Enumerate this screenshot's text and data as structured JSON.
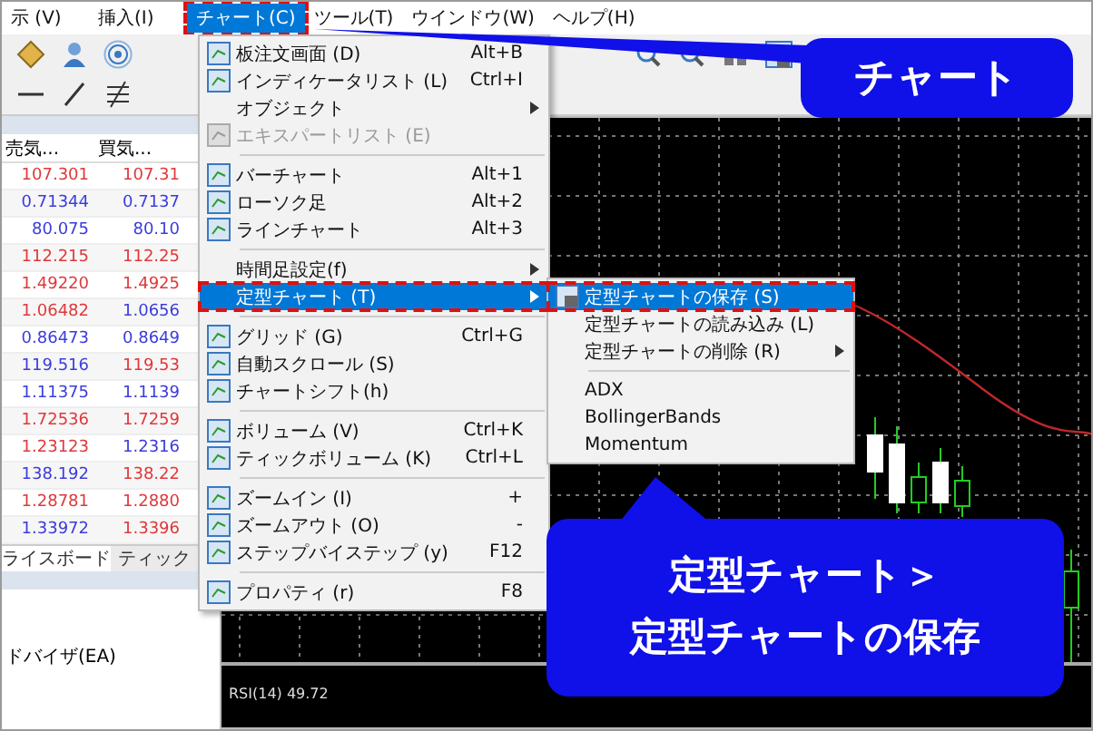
{
  "menubar": [
    {
      "label": "示 (V)",
      "selected": false
    },
    {
      "label": "挿入(I)",
      "selected": false
    },
    {
      "label": "チャート(C)",
      "selected": true
    },
    {
      "label": "ツール(T)",
      "selected": false
    },
    {
      "label": "ウインドウ(W)",
      "selected": false
    },
    {
      "label": "ヘルプ(H)",
      "selected": false
    }
  ],
  "market_watch": {
    "columns": [
      "売気...",
      "買気..."
    ],
    "rows": [
      {
        "bid": {
          "text": "107.301",
          "color": "#e0383a"
        },
        "ask": {
          "text": "107.31",
          "color": "#e0383a"
        }
      },
      {
        "bid": {
          "text": "0.71344",
          "color": "#3c3cdc"
        },
        "ask": {
          "text": "0.7137",
          "color": "#3c3cdc"
        }
      },
      {
        "bid": {
          "text": "80.075",
          "color": "#3c3cdc"
        },
        "ask": {
          "text": "80.10",
          "color": "#3c3cdc"
        }
      },
      {
        "bid": {
          "text": "112.215",
          "color": "#e0383a"
        },
        "ask": {
          "text": "112.25",
          "color": "#e0383a"
        }
      },
      {
        "bid": {
          "text": "1.49220",
          "color": "#e0383a"
        },
        "ask": {
          "text": "1.4925",
          "color": "#e0383a"
        }
      },
      {
        "bid": {
          "text": "1.06482",
          "color": "#e0383a"
        },
        "ask": {
          "text": "1.0656",
          "color": "#3c3cdc"
        }
      },
      {
        "bid": {
          "text": "0.86473",
          "color": "#3c3cdc"
        },
        "ask": {
          "text": "0.8649",
          "color": "#3c3cdc"
        }
      },
      {
        "bid": {
          "text": "119.516",
          "color": "#3c3cdc"
        },
        "ask": {
          "text": "119.53",
          "color": "#e0383a"
        }
      },
      {
        "bid": {
          "text": "1.11375",
          "color": "#3c3cdc"
        },
        "ask": {
          "text": "1.1139",
          "color": "#3c3cdc"
        }
      },
      {
        "bid": {
          "text": "1.72536",
          "color": "#e0383a"
        },
        "ask": {
          "text": "1.7259",
          "color": "#e0383a"
        }
      },
      {
        "bid": {
          "text": "1.23123",
          "color": "#e0383a"
        },
        "ask": {
          "text": "1.2316",
          "color": "#3c3cdc"
        }
      },
      {
        "bid": {
          "text": "138.192",
          "color": "#3c3cdc"
        },
        "ask": {
          "text": "138.22",
          "color": "#e0383a"
        }
      },
      {
        "bid": {
          "text": "1.28781",
          "color": "#e0383a"
        },
        "ask": {
          "text": "1.2880",
          "color": "#e0383a"
        }
      },
      {
        "bid": {
          "text": "1.33972",
          "color": "#3c3cdc"
        },
        "ask": {
          "text": "1.3396",
          "color": "#e0383a"
        }
      }
    ],
    "tabs": [
      {
        "label": "ライスボード",
        "selected": true
      },
      {
        "label": "ティック",
        "selected": false
      }
    ]
  },
  "navigator": {
    "item": "ドバイザ(EA)"
  },
  "chart_menu": [
    {
      "kind": "item",
      "label": "板注文画面 (D)",
      "shortcut": "Alt+B",
      "icon": true,
      "disabled": false,
      "submenu": false,
      "selected": false
    },
    {
      "kind": "item",
      "label": "インディケータリスト (L)",
      "shortcut": "Ctrl+I",
      "icon": true,
      "disabled": false,
      "submenu": false,
      "selected": false
    },
    {
      "kind": "item",
      "label": "オブジェクト",
      "icon": false,
      "disabled": false,
      "submenu": true,
      "selected": false
    },
    {
      "kind": "item",
      "label": "エキスパートリスト (E)",
      "icon": true,
      "disabled": true,
      "submenu": false,
      "selected": false
    },
    {
      "kind": "separator"
    },
    {
      "kind": "item",
      "label": "バーチャート",
      "shortcut": "Alt+1",
      "icon": true,
      "disabled": false,
      "submenu": false,
      "selected": false
    },
    {
      "kind": "item",
      "label": "ローソク足",
      "shortcut": "Alt+2",
      "icon": true,
      "disabled": false,
      "submenu": false,
      "selected": false
    },
    {
      "kind": "item",
      "label": "ラインチャート",
      "shortcut": "Alt+3",
      "icon": true,
      "disabled": false,
      "submenu": false,
      "selected": false
    },
    {
      "kind": "separator"
    },
    {
      "kind": "item",
      "label": "時間足設定(f)",
      "icon": false,
      "disabled": false,
      "submenu": true,
      "selected": false
    },
    {
      "kind": "item",
      "label": "定型チャート (T)",
      "icon": false,
      "disabled": false,
      "submenu": true,
      "selected": true
    },
    {
      "kind": "separator"
    },
    {
      "kind": "item",
      "label": "グリッド (G)",
      "shortcut": "Ctrl+G",
      "icon": true,
      "disabled": false,
      "submenu": false,
      "selected": false
    },
    {
      "kind": "item",
      "label": "自動スクロール (S)",
      "icon": true,
      "disabled": false,
      "submenu": false,
      "selected": false
    },
    {
      "kind": "item",
      "label": "チャートシフト(h)",
      "icon": true,
      "disabled": false,
      "submenu": false,
      "selected": false
    },
    {
      "kind": "separator"
    },
    {
      "kind": "item",
      "label": "ボリューム (V)",
      "shortcut": "Ctrl+K",
      "icon": true,
      "disabled": false,
      "submenu": false,
      "selected": false
    },
    {
      "kind": "item",
      "label": "ティックボリューム (K)",
      "shortcut": "Ctrl+L",
      "icon": true,
      "disabled": false,
      "submenu": false,
      "selected": false
    },
    {
      "kind": "separator"
    },
    {
      "kind": "item",
      "label": "ズームイン (I)",
      "shortcut": "+",
      "icon": true,
      "disabled": false,
      "submenu": false,
      "selected": false
    },
    {
      "kind": "item",
      "label": "ズームアウト (O)",
      "shortcut": "-",
      "icon": true,
      "disabled": false,
      "submenu": false,
      "selected": false
    },
    {
      "kind": "item",
      "label": "ステップバイステップ (y)",
      "shortcut": "F12",
      "icon": true,
      "disabled": false,
      "submenu": false,
      "selected": false
    },
    {
      "kind": "separator"
    },
    {
      "kind": "item",
      "label": "プロパティ (r)",
      "shortcut": "F8",
      "icon": true,
      "disabled": false,
      "submenu": false,
      "selected": false
    }
  ],
  "template_submenu": [
    {
      "kind": "item",
      "label": "定型チャートの保存 (S)",
      "icon": true,
      "submenu": false,
      "selected": true
    },
    {
      "kind": "item",
      "label": "定型チャートの読み込み (L)",
      "icon": false,
      "submenu": false,
      "selected": false
    },
    {
      "kind": "item",
      "label": "定型チャートの削除 (R)",
      "icon": false,
      "submenu": true,
      "selected": false
    },
    {
      "kind": "separator"
    },
    {
      "kind": "item",
      "label": "ADX",
      "icon": false,
      "submenu": false,
      "selected": false
    },
    {
      "kind": "item",
      "label": "BollingerBands",
      "icon": false,
      "submenu": false,
      "selected": false
    },
    {
      "kind": "item",
      "label": "Momentum",
      "icon": false,
      "submenu": false,
      "selected": false
    }
  ],
  "chart": {
    "indicator_label": "RSI(14) 49.72"
  },
  "callouts": [
    {
      "kind": "top",
      "lines": [
        "チャート"
      ]
    },
    {
      "kind": "bottom",
      "lines": [
        "定型チャート＞",
        "定型チャートの保存"
      ]
    }
  ]
}
